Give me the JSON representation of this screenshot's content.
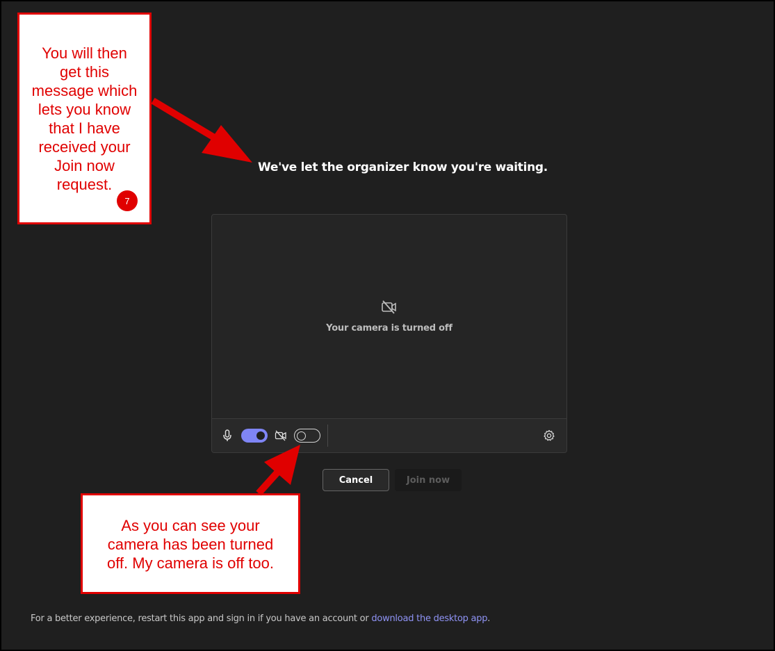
{
  "meeting": {
    "waiting_message": "We've let the organizer know you're waiting.",
    "camera_status": "Your camera is turned off",
    "mic_enabled": true,
    "camera_enabled": false
  },
  "buttons": {
    "cancel": "Cancel",
    "join_now": "Join now"
  },
  "footer": {
    "text": "For a better experience, restart this app and sign in if you have an account or ",
    "link": "download the desktop app",
    "end": "."
  },
  "annotations": {
    "callout_1_lines": [
      "You will then",
      "get this",
      "message which",
      "lets you know",
      "that I have",
      "received your",
      "Join now",
      "request."
    ],
    "callout_2_lines": [
      "As you can see your",
      "camera has been turned",
      "off. My camera is off too."
    ],
    "step_number": "7"
  },
  "colors": {
    "background": "#1f1f1f",
    "accent": "#7f85f5",
    "annotation_red": "#e00000"
  },
  "icons": [
    "camera-off-icon",
    "microphone-icon",
    "camera-off-small-icon",
    "gear-icon"
  ]
}
